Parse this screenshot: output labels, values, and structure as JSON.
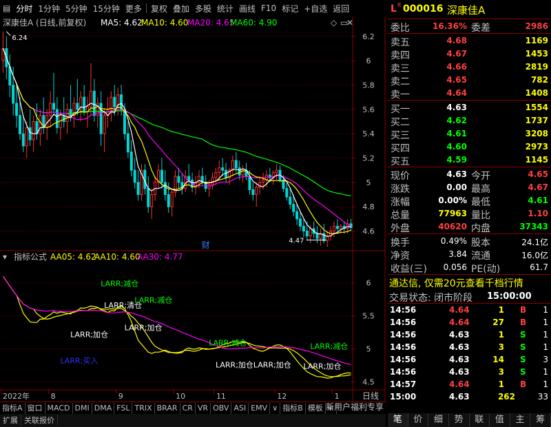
{
  "toolbar": {
    "items": [
      "分时",
      "1分钟",
      "5分钟",
      "15分钟",
      "更多",
      "复权",
      "叠加",
      "多股",
      "统计",
      "画线",
      "F10",
      "标记",
      "+自选",
      "返回"
    ],
    "icon_left": "menu-icon"
  },
  "main_header": {
    "title": "深康佳A (日线,前复权)",
    "ma5_label": "MA5: 4.62",
    "ma10_label": "MA10: 4.60",
    "ma20_label": "MA20: 4.65",
    "ma60_label": "MA60: 4.90"
  },
  "indicator_header": {
    "title": "指标公式",
    "aa05_label": "AA05: 4.62",
    "aa10_label": "AA10: 4.60",
    "aa30_label": "AA30: 4.77"
  },
  "colors": {
    "up": "#ff3030",
    "down": "#00d8d8",
    "ma5": "#ffffff",
    "ma10": "#ffff00",
    "ma20": "#ff00ff",
    "ma60": "#00ff00",
    "axis": "#8b0000",
    "grid": "#8b0000",
    "text_green": "#00ff00",
    "text_white": "#ffffff",
    "text_blue": "#3030ff"
  },
  "chart_data": [
    {
      "type": "candlestick",
      "ylim": [
        4.45,
        6.25
      ],
      "yticks": [
        6.2,
        6.0,
        5.8,
        5.6,
        5.4,
        5.2,
        5.0,
        4.8,
        4.6
      ],
      "xticks": [
        {
          "label": "2022年",
          "index": 0
        },
        {
          "label": "8",
          "index": 14
        },
        {
          "label": "9",
          "index": 34
        },
        {
          "label": "10",
          "index": 51
        },
        {
          "label": "11",
          "index": 63
        },
        {
          "label": "12",
          "index": 81
        },
        {
          "label": "1",
          "index": 98
        }
      ],
      "annotations": [
        {
          "text": "6.24",
          "index": 1,
          "value": 6.24
        },
        {
          "text": "4.47",
          "index": 96,
          "value": 4.47
        },
        {
          "text": "财",
          "index": 60,
          "value": 4.45
        }
      ],
      "ohlc": [
        [
          6.0,
          6.24,
          5.9,
          6.1
        ],
        [
          6.1,
          6.2,
          5.85,
          5.95
        ],
        [
          5.95,
          6.05,
          5.7,
          5.8
        ],
        [
          5.8,
          5.95,
          5.55,
          5.65
        ],
        [
          5.65,
          5.8,
          5.45,
          5.55
        ],
        [
          5.55,
          5.7,
          5.35,
          5.4
        ],
        [
          5.4,
          5.55,
          5.25,
          5.3
        ],
        [
          5.3,
          5.5,
          5.2,
          5.45
        ],
        [
          5.45,
          5.6,
          5.3,
          5.35
        ],
        [
          5.35,
          5.55,
          5.25,
          5.5
        ],
        [
          5.5,
          5.65,
          5.35,
          5.4
        ],
        [
          5.4,
          5.6,
          5.3,
          5.55
        ],
        [
          5.55,
          5.7,
          5.4,
          5.45
        ],
        [
          5.45,
          5.6,
          5.35,
          5.55
        ],
        [
          5.55,
          5.75,
          5.45,
          5.65
        ],
        [
          5.65,
          5.9,
          5.55,
          5.6
        ],
        [
          5.6,
          5.7,
          5.4,
          5.45
        ],
        [
          5.45,
          5.6,
          5.35,
          5.55
        ],
        [
          5.55,
          5.7,
          5.45,
          5.5
        ],
        [
          5.5,
          5.65,
          5.4,
          5.6
        ],
        [
          5.6,
          5.8,
          5.5,
          5.55
        ],
        [
          5.55,
          5.7,
          5.45,
          5.65
        ],
        [
          5.65,
          5.85,
          5.55,
          5.6
        ],
        [
          5.6,
          5.75,
          5.5,
          5.7
        ],
        [
          5.7,
          5.8,
          5.55,
          5.58
        ],
        [
          5.58,
          5.7,
          5.45,
          5.62
        ],
        [
          5.62,
          5.98,
          5.55,
          5.75
        ],
        [
          5.75,
          5.85,
          5.5,
          5.55
        ],
        [
          5.55,
          5.7,
          5.45,
          5.65
        ],
        [
          5.65,
          5.75,
          5.3,
          5.4
        ],
        [
          5.4,
          5.6,
          5.25,
          5.55
        ],
        [
          5.55,
          5.7,
          5.45,
          5.6
        ],
        [
          5.6,
          5.75,
          5.5,
          5.7
        ],
        [
          5.7,
          5.8,
          5.55,
          5.62
        ],
        [
          5.62,
          5.78,
          5.55,
          5.72
        ],
        [
          5.72,
          5.8,
          5.55,
          5.6
        ],
        [
          5.6,
          5.65,
          5.35,
          5.4
        ],
        [
          5.4,
          5.5,
          5.2,
          5.25
        ],
        [
          5.25,
          5.35,
          5.05,
          5.1
        ],
        [
          5.1,
          5.2,
          4.95,
          5.0
        ],
        [
          5.0,
          5.1,
          4.85,
          4.9
        ],
        [
          4.9,
          5.15,
          4.85,
          5.1
        ],
        [
          5.1,
          5.15,
          4.9,
          4.95
        ],
        [
          4.95,
          5.05,
          4.75,
          4.8
        ],
        [
          4.8,
          4.95,
          4.7,
          4.9
        ],
        [
          4.9,
          5.05,
          4.85,
          5.0
        ],
        [
          5.0,
          5.15,
          4.95,
          5.1
        ],
        [
          5.1,
          5.2,
          4.95,
          5.0
        ],
        [
          5.0,
          5.1,
          4.85,
          4.9
        ],
        [
          4.9,
          5.0,
          4.75,
          4.8
        ],
        [
          4.8,
          4.95,
          4.72,
          4.92
        ],
        [
          4.92,
          5.1,
          4.88,
          5.05
        ],
        [
          5.05,
          5.12,
          4.95,
          5.0
        ],
        [
          5.0,
          5.08,
          4.9,
          4.95
        ],
        [
          4.95,
          5.1,
          4.92,
          5.05
        ],
        [
          5.05,
          5.15,
          4.98,
          5.02
        ],
        [
          5.02,
          5.08,
          4.92,
          4.96
        ],
        [
          4.96,
          5.05,
          4.9,
          5.0
        ],
        [
          5.0,
          5.1,
          4.95,
          5.05
        ],
        [
          5.05,
          5.12,
          4.98,
          5.0
        ],
        [
          5.0,
          5.06,
          4.92,
          4.95
        ],
        [
          4.95,
          5.02,
          4.88,
          4.98
        ],
        [
          4.98,
          5.08,
          4.94,
          5.04
        ],
        [
          5.04,
          5.12,
          4.98,
          5.08
        ],
        [
          5.08,
          5.18,
          5.02,
          5.12
        ],
        [
          5.12,
          5.2,
          5.05,
          5.1
        ],
        [
          5.1,
          5.16,
          5.0,
          5.04
        ],
        [
          5.04,
          5.12,
          4.98,
          5.1
        ],
        [
          5.1,
          5.22,
          5.05,
          5.18
        ],
        [
          5.18,
          5.25,
          5.08,
          5.12
        ],
        [
          5.12,
          5.18,
          5.02,
          5.06
        ],
        [
          5.06,
          5.14,
          5.0,
          5.1
        ],
        [
          5.1,
          5.16,
          5.02,
          5.05
        ],
        [
          5.05,
          5.1,
          4.9,
          4.94
        ],
        [
          4.94,
          5.0,
          4.85,
          4.9
        ],
        [
          4.9,
          5.0,
          4.8,
          4.96
        ],
        [
          4.96,
          5.05,
          4.9,
          5.0
        ],
        [
          5.0,
          5.08,
          4.94,
          5.02
        ],
        [
          5.02,
          5.1,
          4.96,
          5.06
        ],
        [
          5.06,
          5.12,
          5.0,
          5.04
        ],
        [
          5.04,
          5.1,
          4.98,
          5.08
        ],
        [
          5.08,
          5.15,
          5.02,
          5.1
        ],
        [
          5.1,
          5.14,
          5.0,
          5.02
        ],
        [
          5.02,
          5.06,
          4.92,
          4.95
        ],
        [
          4.95,
          5.0,
          4.85,
          4.88
        ],
        [
          4.88,
          4.95,
          4.78,
          4.82
        ],
        [
          4.82,
          4.9,
          4.72,
          4.76
        ],
        [
          4.76,
          4.82,
          4.65,
          4.7
        ],
        [
          4.7,
          4.76,
          4.6,
          4.64
        ],
        [
          4.64,
          4.7,
          4.55,
          4.6
        ],
        [
          4.6,
          4.68,
          4.52,
          4.56
        ],
        [
          4.56,
          4.65,
          4.5,
          4.62
        ],
        [
          4.62,
          4.68,
          4.54,
          4.58
        ],
        [
          4.58,
          4.64,
          4.5,
          4.54
        ],
        [
          4.54,
          4.62,
          4.48,
          4.58
        ],
        [
          4.58,
          4.66,
          4.5,
          4.52
        ],
        [
          4.52,
          4.6,
          4.47,
          4.56
        ],
        [
          4.56,
          4.64,
          4.52,
          4.6
        ],
        [
          4.6,
          4.68,
          4.55,
          4.64
        ],
        [
          4.64,
          4.7,
          4.58,
          4.62
        ],
        [
          4.62,
          4.66,
          4.58,
          4.64
        ],
        [
          4.64,
          4.68,
          4.58,
          4.62
        ],
        [
          4.62,
          4.7,
          4.58,
          4.66
        ],
        [
          4.66,
          4.7,
          4.6,
          4.63
        ]
      ]
    },
    {
      "type": "line",
      "ylim": [
        4.4,
        6.3
      ],
      "yticks": [
        6.0,
        5.5,
        5.0,
        4.5
      ],
      "series": [
        {
          "name": "AA05",
          "color": "#ffff00",
          "period": 5
        },
        {
          "name": "AA10",
          "color": "#ffff00",
          "period": 10
        },
        {
          "name": "AA30",
          "color": "#ff00ff",
          "period": 30
        }
      ],
      "annotations": [
        {
          "text": "LARR;减仓",
          "index": 33,
          "value": 5.95,
          "color": "#00ff00"
        },
        {
          "text": "LARR;清仓",
          "index": 34,
          "value": 5.62,
          "color": "#ffffff"
        },
        {
          "text": "LARR;减仓",
          "index": 43,
          "value": 5.7,
          "color": "#00ff00"
        },
        {
          "text": "LARR;加仓",
          "index": 24,
          "value": 5.18,
          "color": "#ffffff"
        },
        {
          "text": "LARR;加仓",
          "index": 40,
          "value": 5.28,
          "color": "#ffffff"
        },
        {
          "text": "LARR;买入",
          "index": 21,
          "value": 4.78,
          "color": "#3030ff"
        },
        {
          "text": "LARR;减仓",
          "index": 65,
          "value": 5.05,
          "color": "#00ff00"
        },
        {
          "text": "LARR;加仓LARR;加仓",
          "index": 67,
          "value": 4.72,
          "color": "#ffffff"
        },
        {
          "text": "LARR;减仓",
          "index": 95,
          "value": 5.0,
          "color": "#00ff00"
        },
        {
          "text": "LARR;加仓",
          "index": 93,
          "value": 4.7,
          "color": "#ffffff"
        }
      ]
    }
  ],
  "axis_label_right": "日线",
  "bottom_tabs": [
    "指标A",
    "窗口",
    "MACD",
    "DMI",
    "DMA",
    "FSL",
    "TRIX",
    "BRAR",
    "CR",
    "VR",
    "OBV",
    "ASI",
    "EMV",
    "∨",
    "指标B",
    "模板",
    "+"
  ],
  "status_bar": [
    "扩展",
    "关联报价"
  ],
  "right_panel": {
    "code_prefix": "L",
    "code_badge": "R",
    "code": "000016",
    "name": "深康佳A",
    "weibi_label": "委比",
    "weibi": "16.36%",
    "weicha_label": "委差",
    "weicha": "2986",
    "sell": [
      {
        "label": "卖五",
        "price": "4.68",
        "vol": "1169"
      },
      {
        "label": "卖四",
        "price": "4.67",
        "vol": "1453"
      },
      {
        "label": "卖三",
        "price": "4.66",
        "vol": "2819"
      },
      {
        "label": "卖二",
        "price": "4.65",
        "vol": "782"
      },
      {
        "label": "卖一",
        "price": "4.64",
        "vol": "1408"
      }
    ],
    "buy": [
      {
        "label": "买一",
        "price": "4.63",
        "vol": "1554"
      },
      {
        "label": "买二",
        "price": "4.62",
        "vol": "1737"
      },
      {
        "label": "买三",
        "price": "4.61",
        "vol": "3208"
      },
      {
        "label": "买四",
        "price": "4.60",
        "vol": "2973"
      },
      {
        "label": "买五",
        "price": "4.59",
        "vol": "1145"
      }
    ],
    "stats": [
      {
        "l1": "现价",
        "v1": "4.63",
        "l2": "今开",
        "v2": "4.65",
        "c2": "red"
      },
      {
        "l1": "涨跌",
        "v1": "0.00",
        "l2": "最高",
        "v2": "4.67",
        "c2": "red"
      },
      {
        "l1": "涨幅",
        "v1": "0.00%",
        "l2": "最低",
        "v2": "4.61",
        "c2": "green"
      },
      {
        "l1": "总量",
        "v1": "77963",
        "l2": "量比",
        "v2": "1.10",
        "c1": "yellow",
        "c2": "red"
      },
      {
        "l1": "外盘",
        "v1": "40620",
        "l2": "内盘",
        "v2": "37343",
        "c1": "red",
        "c2": "green"
      }
    ],
    "stats2": [
      {
        "l1": "换手",
        "v1": "0.49%",
        "l2": "股本",
        "v2": "24.1亿"
      },
      {
        "l1": "净资",
        "v1": "3.84",
        "l2": "流通",
        "v2": "16.0亿"
      },
      {
        "l1": "收益(三)",
        "v1": "0.056",
        "l2": "PE(动)",
        "v2": "61.7"
      }
    ],
    "promo": "通达信, 仅需20元查看千档行情",
    "trade_status_label": "交易状态: 闭市阶段",
    "trade_status_time": "15:00:00",
    "trades": [
      {
        "time": "14:56",
        "price": "4.64",
        "vol": "1",
        "dir": "B",
        "extra": "1",
        "pc": "red"
      },
      {
        "time": "14:56",
        "price": "4.64",
        "vol": "27",
        "dir": "B",
        "extra": "1",
        "pc": "red"
      },
      {
        "time": "14:56",
        "price": "4.63",
        "vol": "1",
        "dir": "S",
        "extra": "1",
        "pc": "white"
      },
      {
        "time": "14:56",
        "price": "4.63",
        "vol": "3",
        "dir": "S",
        "extra": "1",
        "pc": "white"
      },
      {
        "time": "14:56",
        "price": "4.63",
        "vol": "14",
        "dir": "S",
        "extra": "3",
        "pc": "white"
      },
      {
        "time": "14:56",
        "price": "4.63",
        "vol": "3",
        "dir": "S",
        "extra": "1",
        "pc": "white"
      },
      {
        "time": "14:57",
        "price": "4.64",
        "vol": "1",
        "dir": "B",
        "extra": "1",
        "pc": "red"
      },
      {
        "time": "15:00",
        "price": "4.63",
        "vol": "262",
        "dir": "",
        "extra": "33",
        "pc": "white"
      }
    ],
    "new_user_label": "新用户福利专享",
    "tabs": [
      "笔",
      "价",
      "细",
      "势",
      "联",
      "值",
      "主",
      "筹"
    ]
  }
}
